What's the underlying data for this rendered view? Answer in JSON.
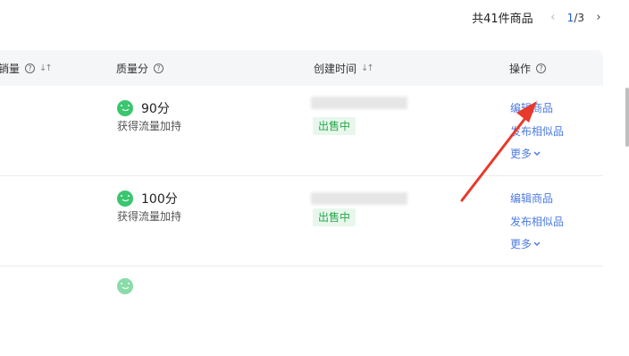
{
  "pager": {
    "total": "共41件商品",
    "prev_icon": "‹",
    "current_page": "1",
    "page_separator": "/",
    "total_pages": "3",
    "next_icon": "›"
  },
  "header": {
    "sales": "销量",
    "quality": "质量分",
    "created": "创建时间",
    "actions": "操作",
    "help_icon": "?",
    "sort_icon": "↓↑"
  },
  "rows": [
    {
      "score": "90分",
      "score_note": "获得流量加持",
      "status": "出售中",
      "actions": {
        "edit": "编辑商品",
        "publish_similar": "发布相似品",
        "more": "更多"
      }
    },
    {
      "score": "100分",
      "score_note": "获得流量加持",
      "status": "出售中",
      "actions": {
        "edit": "编辑商品",
        "publish_similar": "发布相似品",
        "more": "更多"
      }
    }
  ],
  "colors": {
    "link": "#4d7be0",
    "status_green": "#27a84b",
    "smile_green": "#3ac66e",
    "annotation_arrow": "#e8392b"
  },
  "icons": {
    "smile": "smile-face-icon",
    "chevron": "chevron-down-icon"
  }
}
